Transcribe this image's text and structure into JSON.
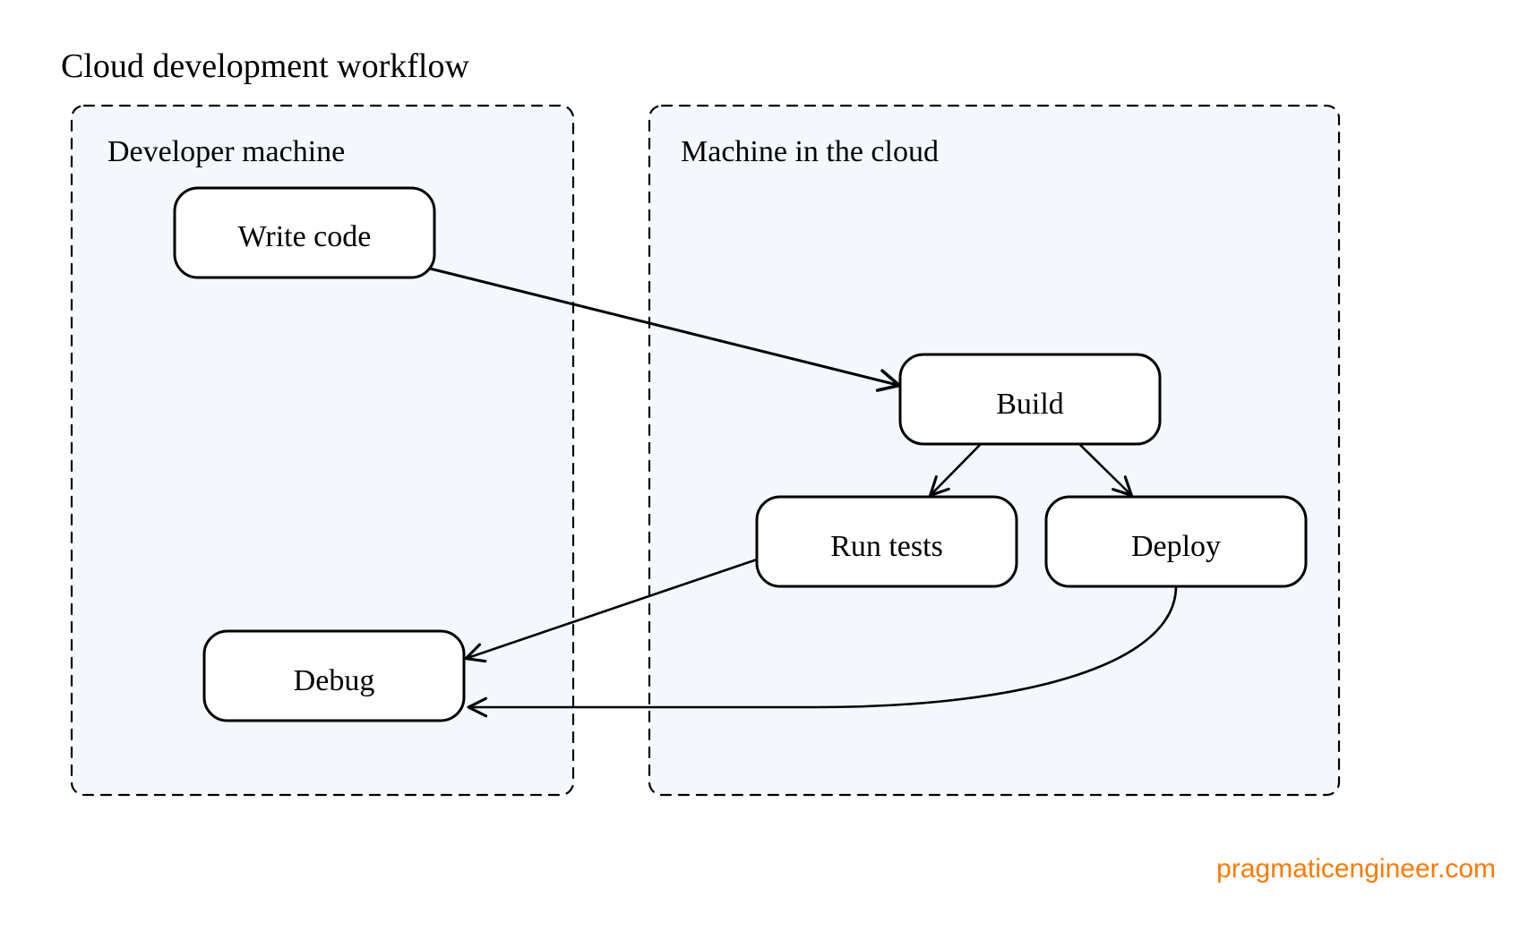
{
  "title": "Cloud development workflow",
  "attribution": "pragmaticengineer.com",
  "groups": {
    "dev": {
      "label": "Developer machine"
    },
    "cloud": {
      "label": "Machine in the cloud"
    }
  },
  "nodes": {
    "write": {
      "label": "Write code"
    },
    "build": {
      "label": "Build"
    },
    "tests": {
      "label": "Run tests"
    },
    "deploy": {
      "label": "Deploy"
    },
    "debug": {
      "label": "Debug"
    }
  },
  "edges": [
    {
      "from": "write",
      "to": "build"
    },
    {
      "from": "build",
      "to": "tests"
    },
    {
      "from": "build",
      "to": "deploy"
    },
    {
      "from": "tests",
      "to": "debug"
    },
    {
      "from": "deploy",
      "to": "debug"
    }
  ]
}
